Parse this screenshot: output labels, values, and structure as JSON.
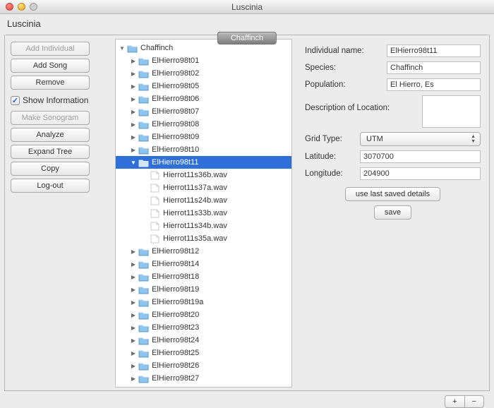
{
  "window": {
    "title": "Luscinia",
    "label": "Luscinia"
  },
  "tab": {
    "label": "Chaffinch"
  },
  "sidebar": {
    "buttons": {
      "add_individual": "Add Individual",
      "add_song": "Add Song",
      "remove": "Remove",
      "make_sonogram": "Make Sonogram",
      "analyze": "Analyze",
      "expand_tree": "Expand Tree",
      "copy": "Copy",
      "logout": "Log-out"
    },
    "show_info": {
      "label": "Show Information",
      "checked": true
    }
  },
  "tree": {
    "root": "Chaffinch",
    "selected": "ElHierro98t11",
    "folders_before": [
      "ElHierro98t01",
      "ElHierro98t02",
      "ElHierro98t05",
      "ElHierro98t06",
      "ElHierro98t07",
      "ElHierro98t08",
      "ElHierro98t09",
      "ElHierro98t10"
    ],
    "files": [
      "Hierrot11s36b.wav",
      "Hierrot11s37a.wav",
      "Hierrot11s24b.wav",
      "Hierrot11s33b.wav",
      "Hierrot11s34b.wav",
      "Hierrot11s35a.wav"
    ],
    "folders_after": [
      "ElHierro98t12",
      "ElHierro98t14",
      "ElHierro98t18",
      "ElHierro98t19",
      "ElHierro98t19a",
      "ElHierro98t20",
      "ElHierro98t23",
      "ElHierro98t24",
      "ElHierro98t25",
      "ElHierro98t26",
      "ElHierro98t27"
    ]
  },
  "form": {
    "individual_name": {
      "label": "Individual name:",
      "value": "ElHierro98t11"
    },
    "species": {
      "label": "Species:",
      "value": "Chaffinch"
    },
    "population": {
      "label": "Population:",
      "value": "El Hierro, Es"
    },
    "description": {
      "label": "Description of Location:",
      "value": ""
    },
    "grid_type": {
      "label": "Grid Type:",
      "value": "UTM"
    },
    "latitude": {
      "label": "Latitude:",
      "value": "3070700"
    },
    "longitude": {
      "label": "Longitude:",
      "value": "204900"
    },
    "use_last": "use last saved details",
    "save": "save"
  },
  "footer": {
    "plus": "+",
    "minus": "−"
  },
  "icons": {
    "check": "✓"
  }
}
